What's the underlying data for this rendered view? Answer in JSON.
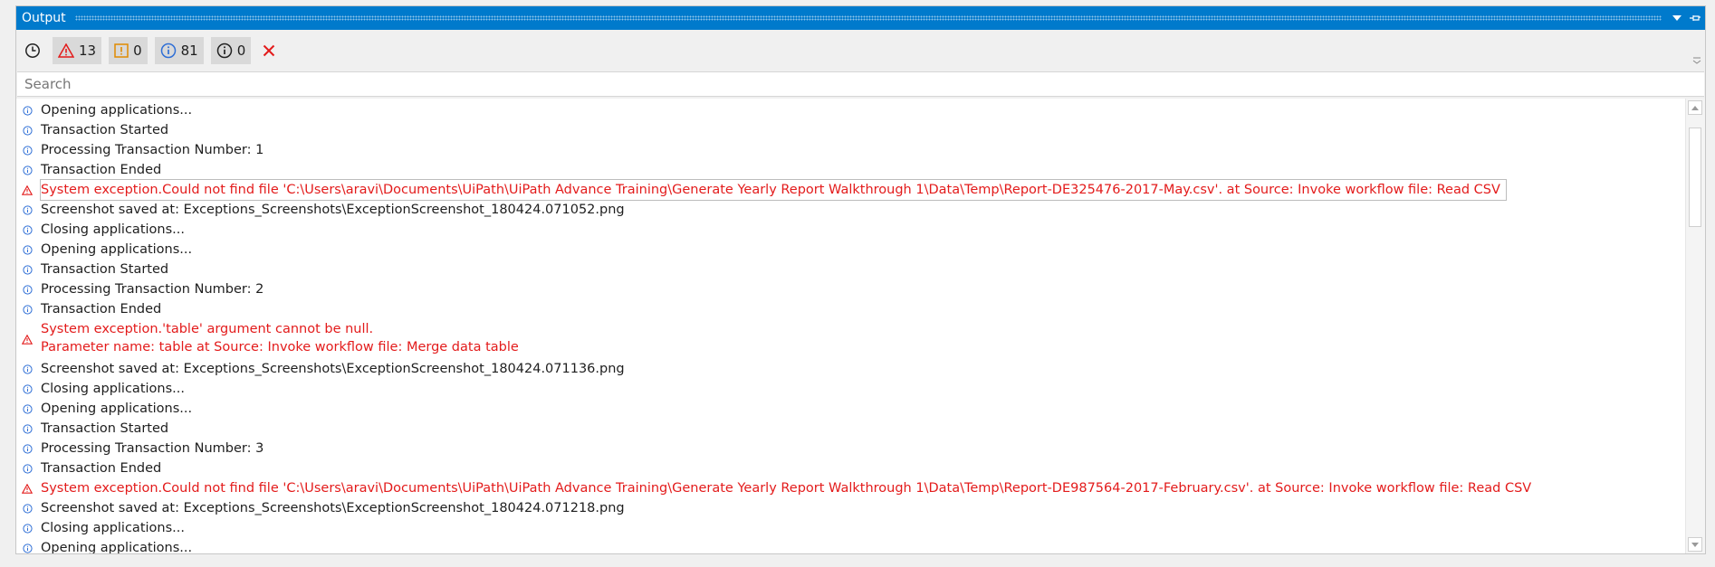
{
  "panel": {
    "title": "Output",
    "colors": {
      "titlebar": "#007acc",
      "error": "#e31b1b",
      "info": "#2f6fd6"
    }
  },
  "toolbar": {
    "filters": [
      {
        "name": "errors",
        "icon": "error-triangle-icon",
        "count": "13"
      },
      {
        "name": "warnings",
        "icon": "warning-icon",
        "count": "0"
      },
      {
        "name": "info",
        "icon": "info-icon",
        "count": "81"
      },
      {
        "name": "trace",
        "icon": "trace-info-icon",
        "count": "0"
      }
    ]
  },
  "search": {
    "placeholder": "Search",
    "value": ""
  },
  "log": [
    {
      "level": "info",
      "lines": [
        "Opening applications..."
      ]
    },
    {
      "level": "info",
      "lines": [
        "Transaction Started"
      ]
    },
    {
      "level": "info",
      "lines": [
        "Processing Transaction Number: 1"
      ]
    },
    {
      "level": "info",
      "lines": [
        "Transaction Ended"
      ]
    },
    {
      "level": "error",
      "selected": true,
      "lines": [
        "System exception.Could not find file 'C:\\Users\\aravi\\Documents\\UiPath\\UiPath Advance Training\\Generate Yearly Report Walkthrough 1\\Data\\Temp\\Report-DE325476-2017-May.csv'. at Source: Invoke workflow file: Read CSV"
      ]
    },
    {
      "level": "info",
      "lines": [
        "Screenshot saved at: Exceptions_Screenshots\\ExceptionScreenshot_180424.071052.png"
      ]
    },
    {
      "level": "info",
      "lines": [
        "Closing applications..."
      ]
    },
    {
      "level": "info",
      "lines": [
        "Opening applications..."
      ]
    },
    {
      "level": "info",
      "lines": [
        "Transaction Started"
      ]
    },
    {
      "level": "info",
      "lines": [
        "Processing Transaction Number: 2"
      ]
    },
    {
      "level": "info",
      "lines": [
        "Transaction Ended"
      ]
    },
    {
      "level": "error",
      "lines": [
        "System exception.'table' argument cannot be null.",
        "Parameter name: table at Source: Invoke workflow file: Merge data table"
      ]
    },
    {
      "level": "info",
      "lines": [
        "Screenshot saved at: Exceptions_Screenshots\\ExceptionScreenshot_180424.071136.png"
      ]
    },
    {
      "level": "info",
      "lines": [
        "Closing applications..."
      ]
    },
    {
      "level": "info",
      "lines": [
        "Opening applications..."
      ]
    },
    {
      "level": "info",
      "lines": [
        "Transaction Started"
      ]
    },
    {
      "level": "info",
      "lines": [
        "Processing Transaction Number: 3"
      ]
    },
    {
      "level": "info",
      "lines": [
        "Transaction Ended"
      ]
    },
    {
      "level": "error",
      "lines": [
        "System exception.Could not find file 'C:\\Users\\aravi\\Documents\\UiPath\\UiPath Advance Training\\Generate Yearly Report Walkthrough 1\\Data\\Temp\\Report-DE987564-2017-February.csv'. at Source: Invoke workflow file: Read CSV"
      ]
    },
    {
      "level": "info",
      "lines": [
        "Screenshot saved at: Exceptions_Screenshots\\ExceptionScreenshot_180424.071218.png"
      ]
    },
    {
      "level": "info",
      "lines": [
        "Closing applications..."
      ]
    },
    {
      "level": "info",
      "lines": [
        "Opening applications..."
      ]
    }
  ]
}
